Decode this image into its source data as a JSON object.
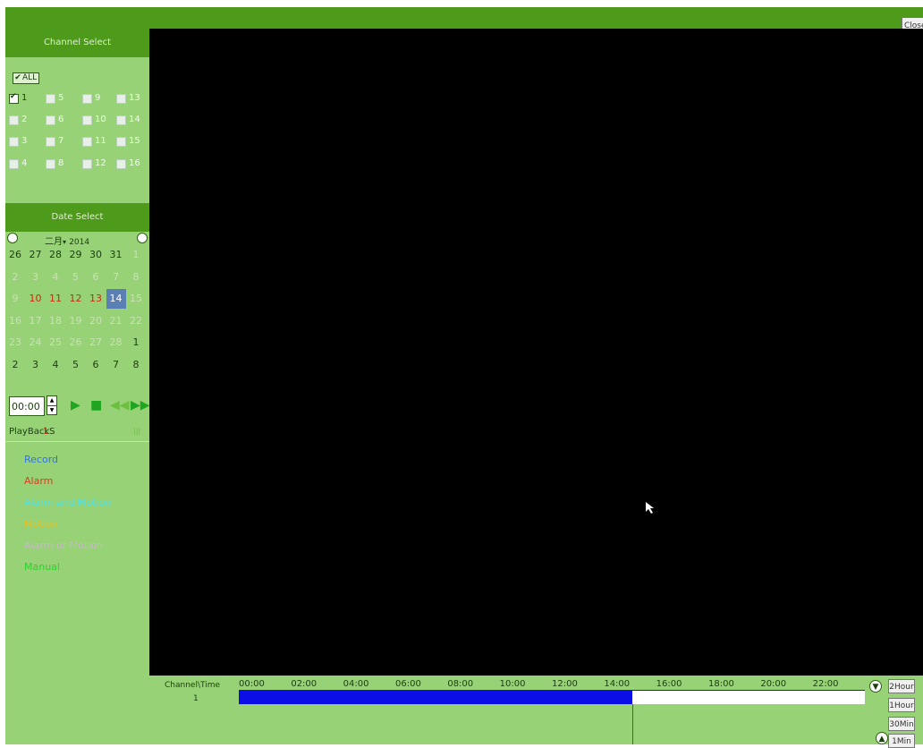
{
  "window": {
    "close_label": "Close"
  },
  "channel_select": {
    "title": "Channel Select",
    "all_label": "ALL",
    "all_checked": true,
    "channels": [
      {
        "label": "1",
        "checked": true
      },
      {
        "label": "5",
        "checked": false
      },
      {
        "label": "9",
        "checked": false
      },
      {
        "label": "13",
        "checked": false
      },
      {
        "label": "2",
        "checked": false
      },
      {
        "label": "6",
        "checked": false
      },
      {
        "label": "10",
        "checked": false
      },
      {
        "label": "14",
        "checked": false
      },
      {
        "label": "3",
        "checked": false
      },
      {
        "label": "7",
        "checked": false
      },
      {
        "label": "11",
        "checked": false
      },
      {
        "label": "15",
        "checked": false
      },
      {
        "label": "4",
        "checked": false
      },
      {
        "label": "8",
        "checked": false
      },
      {
        "label": "12",
        "checked": false
      },
      {
        "label": "16",
        "checked": false
      }
    ]
  },
  "date_select": {
    "title": "Date Select",
    "month_label": "二月",
    "year_label": "2014",
    "weeks": [
      [
        {
          "d": "26",
          "s": "dark"
        },
        {
          "d": "27",
          "s": "dark"
        },
        {
          "d": "28",
          "s": "dark"
        },
        {
          "d": "29",
          "s": "dark"
        },
        {
          "d": "30",
          "s": "dark"
        },
        {
          "d": "31",
          "s": "dark"
        },
        {
          "d": "1",
          "s": "grey"
        }
      ],
      [
        {
          "d": "2",
          "s": "grey"
        },
        {
          "d": "3",
          "s": "grey"
        },
        {
          "d": "4",
          "s": "grey"
        },
        {
          "d": "5",
          "s": "grey"
        },
        {
          "d": "6",
          "s": "grey"
        },
        {
          "d": "7",
          "s": "grey"
        },
        {
          "d": "8",
          "s": "grey"
        }
      ],
      [
        {
          "d": "9",
          "s": "grey"
        },
        {
          "d": "10",
          "s": "red"
        },
        {
          "d": "11",
          "s": "red"
        },
        {
          "d": "12",
          "s": "red"
        },
        {
          "d": "13",
          "s": "red"
        },
        {
          "d": "14",
          "s": "sel"
        },
        {
          "d": "15",
          "s": "grey"
        }
      ],
      [
        {
          "d": "16",
          "s": "grey"
        },
        {
          "d": "17",
          "s": "grey"
        },
        {
          "d": "18",
          "s": "grey"
        },
        {
          "d": "19",
          "s": "grey"
        },
        {
          "d": "20",
          "s": "grey"
        },
        {
          "d": "21",
          "s": "grey"
        },
        {
          "d": "22",
          "s": "grey"
        }
      ],
      [
        {
          "d": "23",
          "s": "grey"
        },
        {
          "d": "24",
          "s": "grey"
        },
        {
          "d": "25",
          "s": "grey"
        },
        {
          "d": "26",
          "s": "grey"
        },
        {
          "d": "27",
          "s": "grey"
        },
        {
          "d": "28",
          "s": "grey"
        },
        {
          "d": "1",
          "s": "dark"
        }
      ],
      [
        {
          "d": "2",
          "s": "dark"
        },
        {
          "d": "3",
          "s": "dark"
        },
        {
          "d": "4",
          "s": "dark"
        },
        {
          "d": "5",
          "s": "dark"
        },
        {
          "d": "6",
          "s": "dark"
        },
        {
          "d": "7",
          "s": "dark"
        },
        {
          "d": "8",
          "s": "dark"
        }
      ]
    ]
  },
  "playback": {
    "time_value": "00:00",
    "speed_label": "PlayBackS",
    "speed_value": "1"
  },
  "legend": [
    {
      "label": "Record",
      "color": "#2f72e6"
    },
    {
      "label": "Alarm",
      "color": "#e23a1a"
    },
    {
      "label": "Alarm and Motion",
      "color": "#4fe0e8"
    },
    {
      "label": "Motion",
      "color": "#e0c32a"
    },
    {
      "label": "Alarm or Motion",
      "color": "#c8b8c8"
    },
    {
      "label": "Manual",
      "color": "#2fd12f"
    }
  ],
  "timeline": {
    "header": "Channel\\Time",
    "channel": "1",
    "hours": [
      "00:00",
      "02:00",
      "04:00",
      "06:00",
      "08:00",
      "10:00",
      "12:00",
      "14:00",
      "16:00",
      "18:00",
      "20:00",
      "22:00"
    ],
    "recorded_until_hour": 15.1,
    "zoom_buttons": [
      "2Hour",
      "1Hour",
      "30Min",
      "1Min"
    ]
  },
  "colors": {
    "header_green": "#4e9a1a",
    "panel_green": "#97d277",
    "record_blue": "#0b0fe6"
  }
}
